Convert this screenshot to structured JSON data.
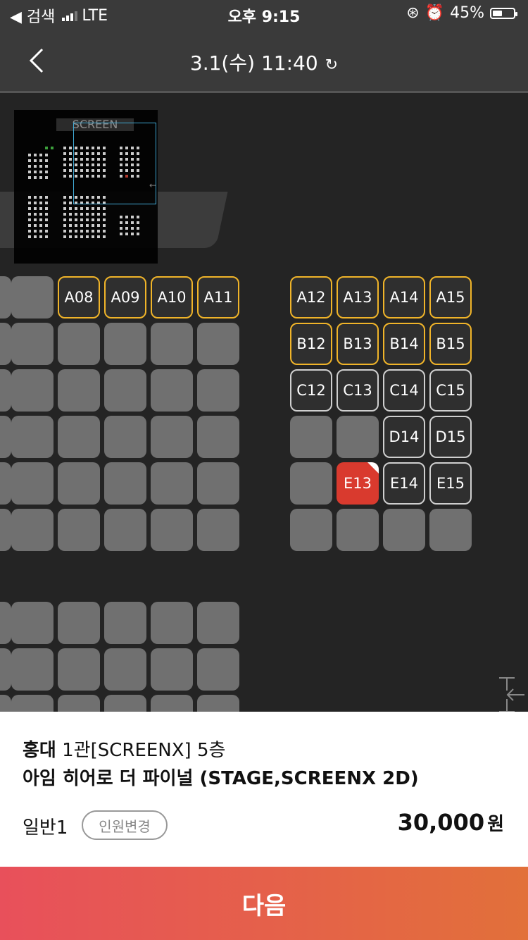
{
  "status": {
    "back_app": "◀ 검색",
    "network": "LTE",
    "time": "오후 9:15",
    "battery": "45%",
    "battery_level": 0.45
  },
  "header": {
    "title": "3.1(수) 11:40"
  },
  "minimap": {
    "screen_label": "SCREEN"
  },
  "seats": {
    "A08": "A08",
    "A09": "A09",
    "A10": "A10",
    "A11": "A11",
    "A12": "A12",
    "A13": "A13",
    "A14": "A14",
    "A15": "A15",
    "B12": "B12",
    "B13": "B13",
    "B14": "B14",
    "B15": "B15",
    "C12": "C12",
    "C13": "C13",
    "C14": "C14",
    "C15": "C15",
    "D14": "D14",
    "D15": "D15",
    "E13": "E13",
    "E14": "E14",
    "E15": "E15"
  },
  "booking": {
    "cinema": "홍대",
    "hall": "1관[SCREENX] 5층",
    "movie": "아임 히어로 더 파이널 (STAGE,SCREENX 2D)",
    "audience": "일반1",
    "change_label": "인원변경",
    "price": "30,000",
    "currency": "원"
  },
  "next_label": "다음"
}
